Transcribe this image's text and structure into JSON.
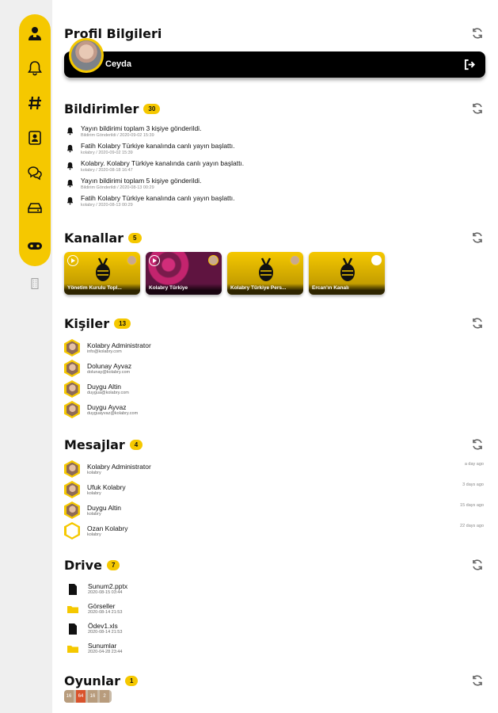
{
  "colors": {
    "accent": "#f5c800",
    "dark": "#000000"
  },
  "rail": {
    "items": [
      {
        "icon": "profile-icon"
      },
      {
        "icon": "bell-icon"
      },
      {
        "icon": "hashtag-icon"
      },
      {
        "icon": "contacts-icon"
      },
      {
        "icon": "chat-icon"
      },
      {
        "icon": "drive-icon"
      },
      {
        "icon": "gamepad-icon"
      }
    ],
    "extra_icon": "building-icon"
  },
  "profile": {
    "title": "Profil Bilgileri",
    "name": "Ceyda"
  },
  "notifications": {
    "title": "Bildirimler",
    "count": "30",
    "items": [
      {
        "text": "Yayın bildirimi toplam 3 kişiye gönderildi.",
        "sub": "Bildirim Gönderildi / 2020-09-02 15:39"
      },
      {
        "text": "Fatih Kolabry Türkiye kanalında canlı yayın başlattı.",
        "sub": "kolabry / 2020-09-02 15:39"
      },
      {
        "text": "Kolabry. Kolabry Türkiye kanalında canlı yayın başlattı.",
        "sub": "kolabry / 2020-08-18 16:47"
      },
      {
        "text": "Yayın bildirimi toplam 5 kişiye gönderildi.",
        "sub": "Bildirim Gönderildi / 2020-08-13 00:29"
      },
      {
        "text": "Fatih Kolabry Türkiye kanalında canlı yayın başlattı.",
        "sub": "kolabry / 2020-08-13 00:29"
      }
    ]
  },
  "channels": {
    "title": "Kanallar",
    "count": "5",
    "items": [
      {
        "label": "Yönetim Kurulu Topl..."
      },
      {
        "label": "Kolabry Türkiye"
      },
      {
        "label": "Kolabry Türkiye Pers..."
      },
      {
        "label": "Ercan'ın Kanalı"
      }
    ]
  },
  "people": {
    "title": "Kişiler",
    "count": "13",
    "items": [
      {
        "name": "Kolabry Administrator",
        "sub": "info@kolabry.com"
      },
      {
        "name": "Dolunay Ayvaz",
        "sub": "dolunay@kolabry.com"
      },
      {
        "name": "Duygu Altin",
        "sub": "duygua@kolabry.com"
      },
      {
        "name": "Duygu Ayvaz",
        "sub": "duyguayvaz@kolabry.com"
      }
    ]
  },
  "messages": {
    "title": "Mesajlar",
    "count": "4",
    "items": [
      {
        "name": "Kolabry Administrator",
        "sub": "kolabry",
        "time": "a day ago"
      },
      {
        "name": "Ufuk Kolabry",
        "sub": "kolabry",
        "time": "3 days ago"
      },
      {
        "name": "Duygu Altin",
        "sub": "kolabry",
        "time": "15 days ago"
      },
      {
        "name": "Ozan Kolabry",
        "sub": "kolabry",
        "time": "22 days ago"
      }
    ]
  },
  "drive": {
    "title": "Drive",
    "count": "7",
    "items": [
      {
        "icon": "file-icon",
        "name": "Sunum2.pptx",
        "date": "2020-08-15 03:44"
      },
      {
        "icon": "folder-icon",
        "name": "Görseller",
        "date": "2020-08-14 21:53"
      },
      {
        "icon": "file-icon",
        "name": "Ödev1.xls",
        "date": "2020-08-14 21:53"
      },
      {
        "icon": "folder-icon",
        "name": "Sunumlar",
        "date": "2020-04-28 23:44"
      }
    ]
  },
  "games": {
    "title": "Oyunlar",
    "count": "1",
    "tiles": [
      "16",
      "64",
      "16",
      "2"
    ]
  }
}
